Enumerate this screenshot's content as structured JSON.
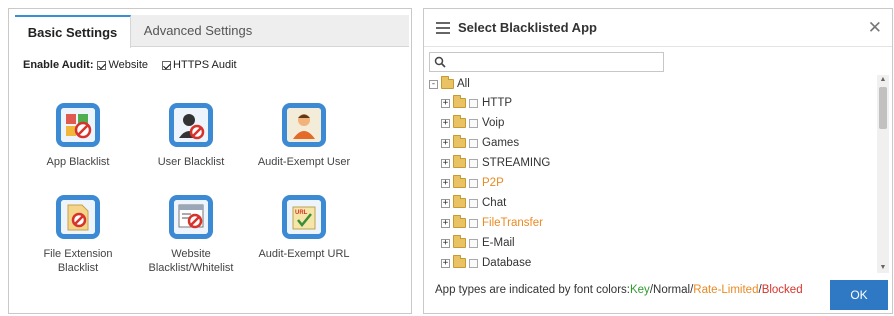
{
  "left": {
    "tabs": [
      {
        "label": "Basic Settings",
        "active": true
      },
      {
        "label": "Advanced Settings",
        "active": false
      }
    ],
    "enable_audit_label": "Enable Audit:",
    "audit_options": [
      {
        "label": "Website",
        "checked": true
      },
      {
        "label": "HTTPS Audit",
        "checked": true
      }
    ],
    "tiles": [
      {
        "label": "App Blacklist",
        "icon": "app-blacklist-icon"
      },
      {
        "label": "User Blacklist",
        "icon": "user-blacklist-icon"
      },
      {
        "label": "Audit-Exempt User",
        "icon": "audit-exempt-user-icon"
      },
      {
        "label": "File Extension\nBlacklist",
        "icon": "file-extension-blacklist-icon"
      },
      {
        "label": "Website\nBlacklist/Whitelist",
        "icon": "website-blacklist-icon"
      },
      {
        "label": "Audit-Exempt URL",
        "icon": "audit-exempt-url-icon"
      }
    ]
  },
  "dialog": {
    "title": "Select Blacklisted App",
    "search_placeholder": "",
    "tree_root": "All",
    "tree_items": [
      {
        "label": "HTTP",
        "type": "normal"
      },
      {
        "label": "Voip",
        "type": "normal"
      },
      {
        "label": "Games",
        "type": "normal"
      },
      {
        "label": "STREAMING",
        "type": "normal"
      },
      {
        "label": "P2P",
        "type": "rate-limited"
      },
      {
        "label": "Chat",
        "type": "normal"
      },
      {
        "label": "FileTransfer",
        "type": "rate-limited"
      },
      {
        "label": "E-Mail",
        "type": "normal"
      },
      {
        "label": "Database",
        "type": "normal"
      }
    ],
    "legend": {
      "prefix": "App types are indicated by font colors:",
      "key": "Key",
      "sep1": "/",
      "normal": "Normal",
      "sep2": "/",
      "rate_limited": "Rate-Limited",
      "sep3": "/",
      "blocked": "Blocked"
    },
    "ok_label": "OK"
  },
  "colors": {
    "accent": "#2f78c4",
    "key": "#2f9c2f",
    "rate_limited": "#ea8a22",
    "blocked": "#d8332b"
  }
}
